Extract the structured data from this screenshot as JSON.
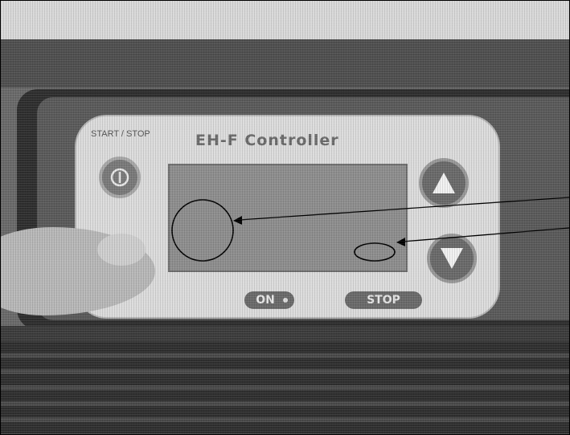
{
  "photo": {
    "subject": "controller-panel",
    "panel_title": "EH-F Controller",
    "start_stop_label": "START / STOP",
    "indicators": {
      "on_label": "ON",
      "stop_label": "STOP"
    },
    "buttons": {
      "power": "power-icon",
      "up": "up-arrow-icon",
      "down": "down-arrow-icon"
    }
  },
  "colors": {
    "annotation": "#000000"
  }
}
